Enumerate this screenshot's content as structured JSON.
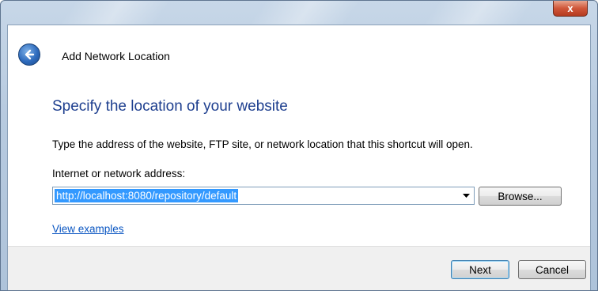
{
  "window": {
    "close_label": "x"
  },
  "wizard": {
    "title": "Add Network Location"
  },
  "page": {
    "heading": "Specify the location of your website",
    "instruction": "Type the address of the website, FTP site, or network location that this shortcut will open.",
    "address_label": "Internet or network address:",
    "address_value": "http://localhost:8080/repository/default",
    "browse_label": "Browse...",
    "examples_link": "View examples"
  },
  "footer": {
    "next_label": "Next",
    "cancel_label": "Cancel"
  },
  "icons": {
    "back": "back-arrow-icon",
    "dropdown": "chevron-down-icon"
  },
  "colors": {
    "heading": "#1e3f8f",
    "link": "#0a56c2",
    "selection": "#3399ff",
    "close": "#c8472b"
  }
}
